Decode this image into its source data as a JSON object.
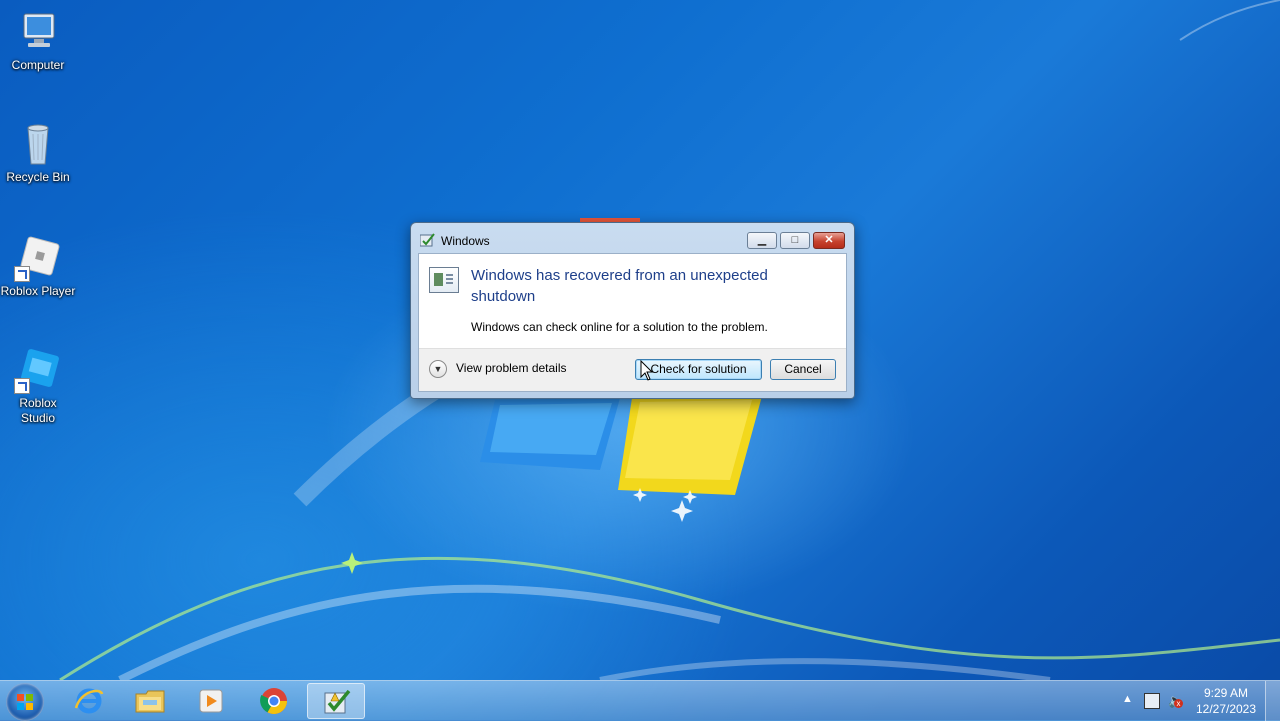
{
  "desktop": {
    "icons": [
      {
        "label": "Computer",
        "icon": "computer-icon"
      },
      {
        "label": "Recycle Bin",
        "icon": "recycle-bin-icon"
      },
      {
        "label": "Roblox Player",
        "icon": "roblox-player-icon"
      },
      {
        "label": "Roblox\nStudio",
        "icon": "roblox-studio-icon"
      }
    ]
  },
  "dialog": {
    "title": "Windows",
    "headline": "Windows has recovered from an unexpected shutdown",
    "message": "Windows can check online for a solution to the problem.",
    "details_label": "View problem details",
    "primary_button": "Check for solution",
    "cancel_button": "Cancel",
    "minimize_glyph": "▁",
    "maximize_glyph": "□",
    "close_glyph": "✕"
  },
  "taskbar": {
    "pinned": [
      {
        "name": "internet-explorer-icon"
      },
      {
        "name": "file-explorer-icon"
      },
      {
        "name": "media-player-icon"
      },
      {
        "name": "chrome-icon"
      },
      {
        "name": "problem-reporting-icon",
        "active": true
      }
    ],
    "tray": {
      "time": "9:29 AM",
      "date": "12/27/2023",
      "overflow_glyph": "▲",
      "volume_glyph": "🔈",
      "mute_glyph": "x"
    }
  },
  "colors": {
    "accent": "#1e3f8a",
    "close_red": "#c7432f"
  }
}
